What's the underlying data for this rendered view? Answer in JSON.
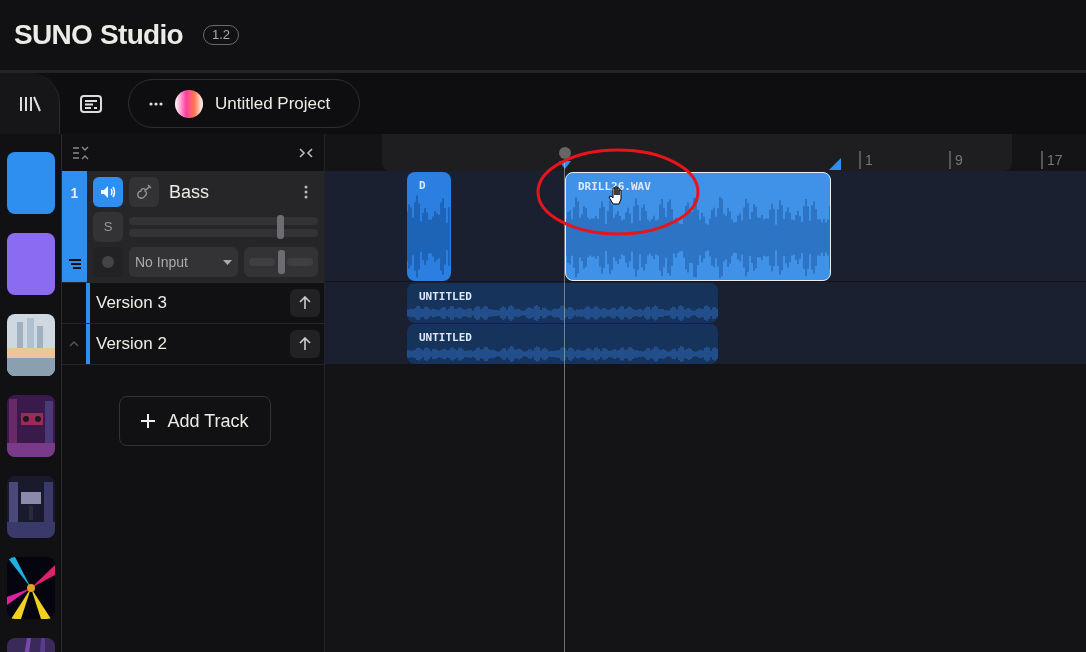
{
  "app": {
    "logo": "SUNO",
    "title": "Studio",
    "version": "1.2"
  },
  "toolbar": {
    "project_name": "Untitled Project"
  },
  "library": [
    {
      "kind": "gradient",
      "color": "#2f8ff0"
    },
    {
      "kind": "gradient",
      "color": "#8a6cf2"
    },
    {
      "kind": "picture"
    },
    {
      "kind": "picture"
    },
    {
      "kind": "picture"
    },
    {
      "kind": "picture"
    },
    {
      "kind": "picture"
    }
  ],
  "track": {
    "number": "1",
    "name": "Bass",
    "selected": true,
    "speaker_on": true,
    "solo": "S",
    "solo_on": false,
    "input": "No Input",
    "volume": {
      "level": 0.8
    },
    "pan": {
      "level": 0.5
    },
    "versions": [
      {
        "name": "Version 3",
        "expanded": false
      },
      {
        "name": "Version 2",
        "expanded": true
      }
    ]
  },
  "add_track": "Add Track",
  "ruler": {
    "ticks": [
      "1",
      "9",
      "17"
    ]
  },
  "clips": [
    {
      "label": "D",
      "selected": false
    },
    {
      "label": "DRILL26.WAV",
      "selected": true
    },
    {
      "label": "UNTITLED",
      "selected": false
    },
    {
      "label": "UNTITLED",
      "selected": false
    }
  ]
}
